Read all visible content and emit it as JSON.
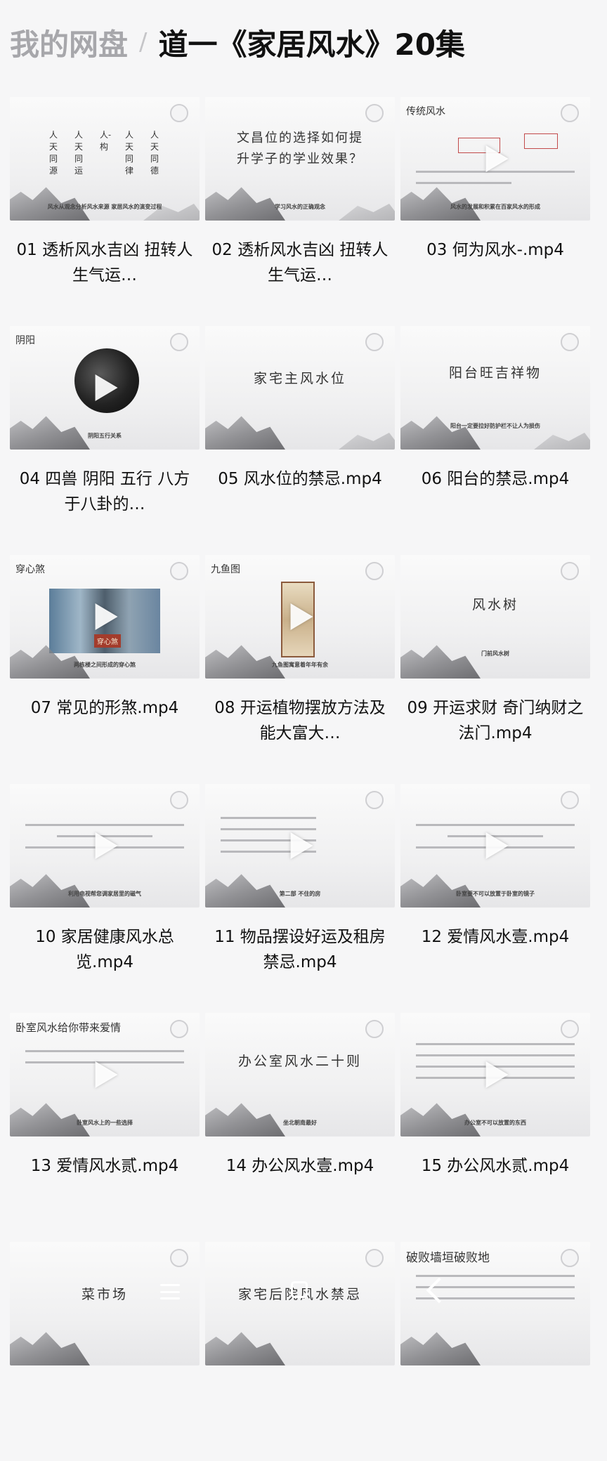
{
  "breadcrumb": {
    "root": "我的网盘",
    "separator": "/",
    "current": "道一《家居风水》20集"
  },
  "files": [
    {
      "name": "01 透析风水吉凶 扭转人生气运…",
      "thumb_columns": [
        "人天同源",
        "人天同运",
        "人-构",
        "人天同律",
        "人天同德"
      ],
      "thumb_caption": "风水从观念分析风水来源 家居风水的演变过程"
    },
    {
      "name": "02 透析风水吉凶 扭转人生气运…",
      "thumb_text": "文昌位的选择如何提升学子的学业效果？",
      "thumb_caption": "学习风水的正确观念"
    },
    {
      "name": "03 何为风水-.mp4",
      "thumb_title": "传统风水",
      "thumb_caption": "风水的发展和积累在百家风水的形成"
    },
    {
      "name": "04 四兽 阴阳 五行 八方于八卦的…",
      "thumb_title": "阴阳",
      "thumb_caption": "阴阳五行关系"
    },
    {
      "name": "05 风水位的禁忌.mp4",
      "thumb_text": "家宅主风水位"
    },
    {
      "name": "06 阳台的禁忌.mp4",
      "thumb_text": "阳台旺吉祥物",
      "thumb_caption": "阳台一定要拉好防护栏不让人为损伤"
    },
    {
      "name": "07 常见的形煞.mp4",
      "thumb_title": "穿心煞",
      "thumb_tag": "穿心煞",
      "thumb_caption": "两栋楼之间形成的穿心煞"
    },
    {
      "name": "08 开运植物摆放方法及能大富大…",
      "thumb_title": "九鱼图",
      "thumb_caption": "九鱼图寓意着年年有余"
    },
    {
      "name": "09 开运求财 奇门纳财之法门.mp4",
      "thumb_text": "风水树",
      "thumb_caption": "门前风水树"
    },
    {
      "name": "10 家居健康风水总览.mp4",
      "thumb_caption": "利用电视帮您调家居里的磁气"
    },
    {
      "name": "11 物品摆设好运及租房禁忌.mp4",
      "thumb_caption": "第二部 不住的房"
    },
    {
      "name": "12 爱情风水壹.mp4",
      "thumb_caption": "卧室要不可以放置于卧室的镜子"
    },
    {
      "name": "13 爱情风水贰.mp4",
      "thumb_title": "卧室风水给你带来爱情",
      "thumb_caption": "卧室风水上的一些选择"
    },
    {
      "name": "14 办公风水壹.mp4",
      "thumb_text": "办公室风水二十则",
      "thumb_caption": "坐北朝南最好"
    },
    {
      "name": "15 办公风水贰.mp4",
      "thumb_caption": "办公室不可以放置的东西"
    },
    {
      "name": "",
      "thumb_text": "菜市场"
    },
    {
      "name": "",
      "thumb_text": "家宅后院风水禁忌"
    },
    {
      "name": "",
      "thumb_title": "破败墙垣破败地"
    }
  ],
  "nav": {
    "menu_icon": "menu-icon",
    "home_icon": "home-icon",
    "back_icon": "back-icon"
  }
}
